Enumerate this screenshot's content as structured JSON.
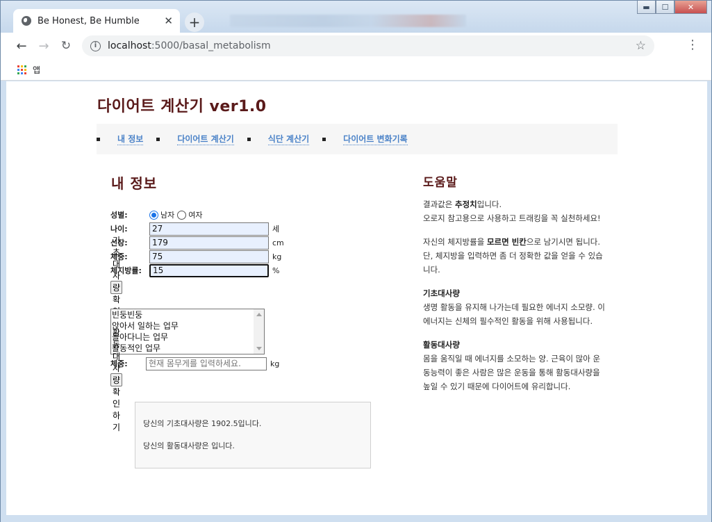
{
  "browser": {
    "tab_title": "Be Honest, Be Humble",
    "new_tab_symbol": "+",
    "url_host": "localhost",
    "url_path": ":5000/basal_metabolism",
    "bookmark_label": "앱",
    "icons": [
      "globe-icon",
      "close-icon",
      "back-arrow-icon",
      "forward-arrow-icon",
      "reload-icon",
      "info-icon",
      "star-icon",
      "menu-icon",
      "apps-grid-icon"
    ],
    "window_controls": {
      "minimize": "▬",
      "maximize": "☐",
      "close": "✕"
    }
  },
  "page": {
    "site_title": "다이어트 계산기 ver1.0",
    "nav": [
      "내 정보",
      "다이어트 계산기",
      "식단 계산기",
      "다이어트 변화기록"
    ],
    "section_title": "내 정보",
    "form": {
      "gender_label": "성별:",
      "gender_male": "남자",
      "gender_female": "여자",
      "gender_selected": "남자",
      "age_label": "나이:",
      "age_value": "27",
      "age_unit": "세",
      "height_label": "신장:",
      "height_value": "179",
      "height_unit": "cm",
      "weight_label": "체중:",
      "weight_value": "75",
      "weight_unit": "kg",
      "bodyfat_label": "체지방률:",
      "bodyfat_value": "15",
      "bodyfat_unit": "%",
      "bmr_button": "기초대사량 확인하기",
      "activity_options": [
        "빈둥빈둥",
        "앉아서 일하는 업무",
        "돌아다니는 업무",
        "활동적인 업무"
      ],
      "weight2_label": "체중:",
      "weight2_placeholder": "현재 몸무게를 입력하세요.",
      "weight2_unit": "kg",
      "activity_button": "활동대사량 확인하기"
    },
    "result": {
      "bmr_text": "당신의 기초대사량은 1902.5입니다.",
      "activity_text": "당신의 활동대사량은 입니다."
    },
    "help": {
      "title": "도움말",
      "p1_pre": "결과값은 ",
      "p1_bold": "추정치",
      "p1_post": "입니다.",
      "p1_line2": "오로지 참고용으로 사용하고 트래킹을 꼭 실천하세요!",
      "p2_pre": "자신의 체지방률을 ",
      "p2_bold": "모르면 빈칸",
      "p2_post": "으로 남기시면 됩니다.",
      "p2_line2": "단, 체지방을 입력하면 좀 더 정확한 값을 얻을 수 있습니다.",
      "bmr_heading": "기초대사량",
      "bmr_desc": "생명 활동을 유지해 나가는데 필요한 에너지 소모량. 이 에너지는 신체의 필수적인 활동을 위해 사용됩니다.",
      "amr_heading": "활동대사량",
      "amr_desc": "몸을 움직일 때 에너지를 소모하는 양. 근육이 많아 운동능력이 좋은 사람은 많은 운동을 통해 활동대사량을 높일 수 있기 때문에 다이어트에 유리합니다."
    }
  }
}
